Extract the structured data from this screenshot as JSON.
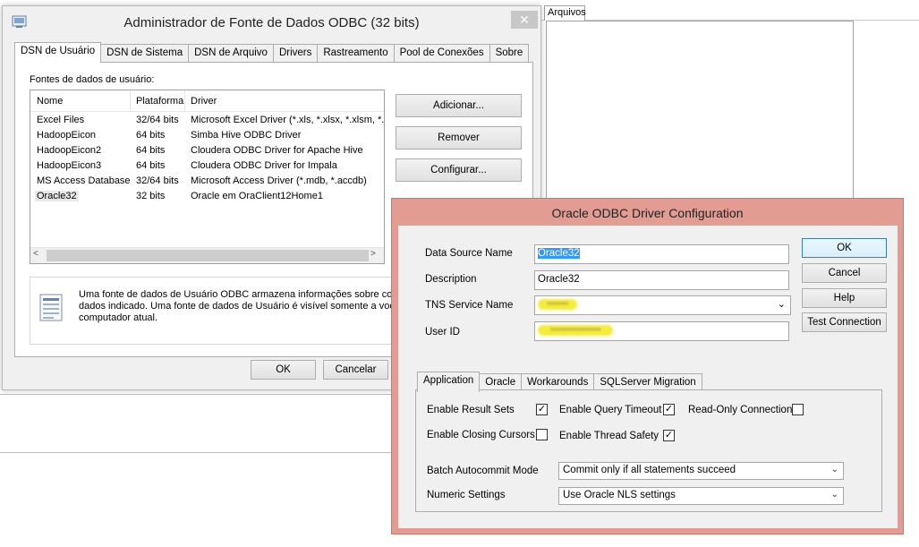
{
  "background": {
    "files_tab_label": "Arquivos"
  },
  "odbc_admin": {
    "title": "Administrador de Fonte de Dados ODBC (32 bits)",
    "close_glyph": "✕",
    "tabs": [
      {
        "label": "DSN de Usuário",
        "active": true
      },
      {
        "label": "DSN de Sistema"
      },
      {
        "label": "DSN de Arquivo"
      },
      {
        "label": "Drivers"
      },
      {
        "label": "Rastreamento"
      },
      {
        "label": "Pool de Conexões"
      },
      {
        "label": "Sobre"
      }
    ],
    "user_ds_label": "Fontes de dados de usuário:",
    "columns": {
      "name": "Nome",
      "platform": "Plataforma",
      "driver": "Driver"
    },
    "rows": [
      {
        "name": "Excel Files",
        "platform": "32/64 bits",
        "driver": "Microsoft Excel Driver (*.xls, *.xlsx, *.xlsm, *.xls"
      },
      {
        "name": "HadoopEicon",
        "platform": "64 bits",
        "driver": "Simba Hive ODBC Driver"
      },
      {
        "name": "HadoopEicon2",
        "platform": "64 bits",
        "driver": "Cloudera ODBC Driver for Apache Hive"
      },
      {
        "name": "HadoopEicon3",
        "platform": "64 bits",
        "driver": "Cloudera ODBC Driver for Impala"
      },
      {
        "name": "MS Access Database",
        "platform": "32/64 bits",
        "driver": "Microsoft Access Driver (*.mdb, *.accdb)"
      },
      {
        "name": "Oracle32",
        "platform": "32 bits",
        "driver": "Oracle em OraClient12Home1"
      }
    ],
    "scroll_left": "<",
    "scroll_right": ">",
    "buttons": {
      "add": "Adicionar...",
      "remove": "Remover",
      "configure": "Configurar...",
      "ok": "OK",
      "cancel": "Cancelar"
    },
    "info": {
      "line1": "Uma fonte de dados de Usuário ODBC armazena informações sobre como",
      "line2": "dados indicado. Uma fonte de dados de Usuário é visível somente a você",
      "line3": "computador atual."
    }
  },
  "oracle_dialog": {
    "title": "Oracle ODBC Driver Configuration",
    "labels": {
      "data_source_name": "Data Source Name",
      "description": "Description",
      "tns_service_name": "TNS Service Name",
      "user_id": "User ID"
    },
    "values": {
      "data_source_name": "Oracle32",
      "description": "Oracle32",
      "tns_service_name_redacted": "••••••",
      "user_id_redacted": "••••••••••••••"
    },
    "buttons": {
      "ok": "OK",
      "cancel": "Cancel",
      "help": "Help",
      "test_connection": "Test Connection"
    },
    "tabs": [
      {
        "label": "Application",
        "active": true
      },
      {
        "label": "Oracle"
      },
      {
        "label": "Workarounds"
      },
      {
        "label": "SQLServer Migration"
      }
    ],
    "options": {
      "enable_result_sets": {
        "label": "Enable Result Sets",
        "checked": true
      },
      "enable_query_timeout": {
        "label": "Enable Query Timeout",
        "checked": true
      },
      "read_only_connection": {
        "label": "Read-Only Connection",
        "checked": false
      },
      "enable_closing_cursors": {
        "label": "Enable Closing Cursors",
        "checked": false
      },
      "enable_thread_safety": {
        "label": "Enable Thread Safety",
        "checked": true
      }
    },
    "check_mark": "✓",
    "batch_autocommit": {
      "label": "Batch Autocommit Mode",
      "value": "Commit only if all statements succeed"
    },
    "numeric_settings": {
      "label": "Numeric Settings",
      "value": "Use Oracle NLS settings"
    },
    "dropdown_arrow": "⌄"
  }
}
